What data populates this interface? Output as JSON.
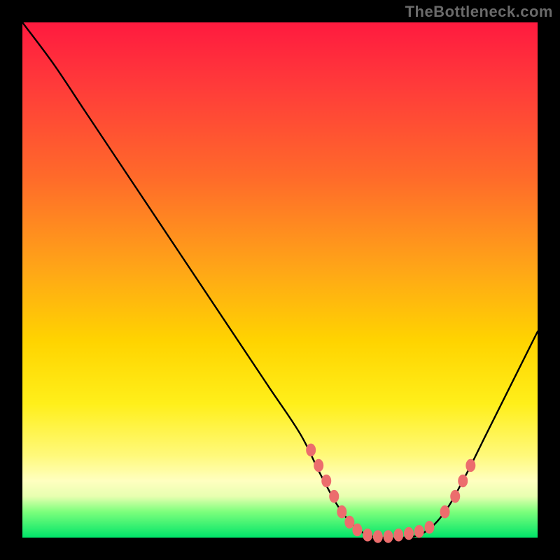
{
  "attribution": "TheBottleneck.com",
  "colors": {
    "page_bg": "#000000",
    "attribution_text": "#6a6a6a",
    "curve_stroke": "#000000",
    "marker_fill": "#ec6d6d",
    "gradient": [
      [
        "0%",
        "#ff1a3f"
      ],
      [
        "12%",
        "#ff3a3a"
      ],
      [
        "30%",
        "#ff6a2a"
      ],
      [
        "48%",
        "#ffa617"
      ],
      [
        "62%",
        "#ffd400"
      ],
      [
        "74%",
        "#ffef1a"
      ],
      [
        "84%",
        "#fff97a"
      ],
      [
        "89%",
        "#ffffc0"
      ],
      [
        "92%",
        "#e7ffb0"
      ],
      [
        "95%",
        "#7cff7c"
      ],
      [
        "100%",
        "#00e469"
      ]
    ]
  },
  "chart_data": {
    "type": "line",
    "title": "",
    "xlabel": "",
    "ylabel": "",
    "xlim": [
      0,
      100
    ],
    "ylim": [
      0,
      100
    ],
    "grid": false,
    "x": [
      0,
      6,
      12,
      18,
      24,
      30,
      36,
      42,
      48,
      54,
      58,
      62,
      66,
      70,
      74,
      78,
      82,
      86,
      90,
      94,
      100
    ],
    "y": [
      100,
      92,
      83,
      74,
      65,
      56,
      47,
      38,
      29,
      20,
      12,
      5,
      1,
      0,
      0,
      1,
      5,
      12,
      20,
      28,
      40
    ],
    "markers": [
      {
        "x": 56,
        "y": 17
      },
      {
        "x": 57.5,
        "y": 14
      },
      {
        "x": 59,
        "y": 11
      },
      {
        "x": 60.5,
        "y": 8
      },
      {
        "x": 62,
        "y": 5
      },
      {
        "x": 63.5,
        "y": 3
      },
      {
        "x": 65,
        "y": 1.5
      },
      {
        "x": 67,
        "y": 0.5
      },
      {
        "x": 69,
        "y": 0.2
      },
      {
        "x": 71,
        "y": 0.2
      },
      {
        "x": 73,
        "y": 0.5
      },
      {
        "x": 75,
        "y": 0.8
      },
      {
        "x": 77,
        "y": 1.2
      },
      {
        "x": 79,
        "y": 2.0
      },
      {
        "x": 82,
        "y": 5
      },
      {
        "x": 84,
        "y": 8
      },
      {
        "x": 85.5,
        "y": 11
      },
      {
        "x": 87,
        "y": 14
      }
    ]
  }
}
